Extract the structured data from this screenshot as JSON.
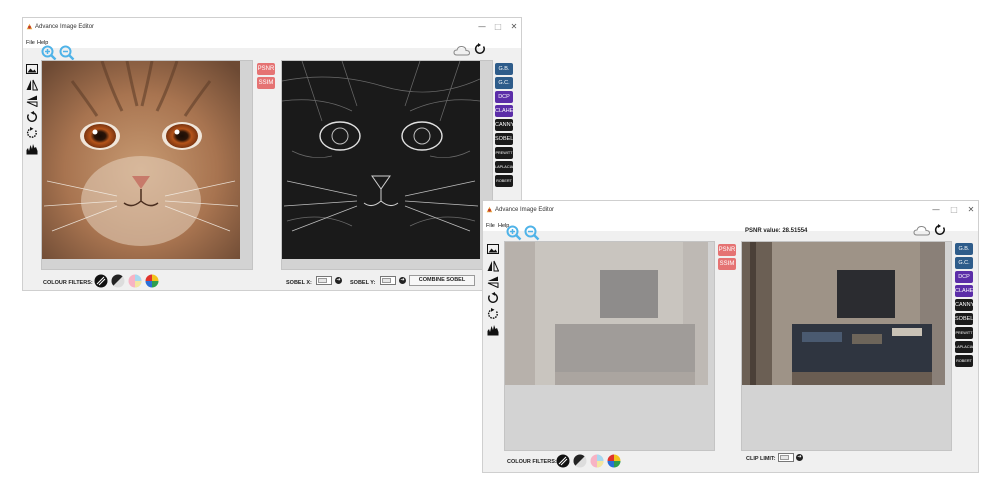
{
  "window_title": "Advance Image Editor",
  "menu": {
    "file": "File",
    "help": "Help"
  },
  "window_buttons": {
    "minimize": "—",
    "maximize": "□",
    "close": "✕"
  },
  "metric_buttons": {
    "psnr": "PSNR",
    "ssim": "SSIM"
  },
  "right_buttons": [
    {
      "label": "G.B.",
      "color": "#2e5c8a"
    },
    {
      "label": "G.C.",
      "color": "#2e5c8a"
    },
    {
      "label": "DCP",
      "color": "#5b2da8"
    },
    {
      "label": "CLAHE",
      "color": "#5b2da8"
    },
    {
      "label": "CANNY",
      "color": "#1a1a1a"
    },
    {
      "label": "SOBEL",
      "color": "#1a1a1a"
    },
    {
      "label": "PREWITT",
      "color": "#1a1a1a"
    },
    {
      "label": "LAPLACIAN",
      "color": "#1a1a1a"
    },
    {
      "label": "ROBERT",
      "color": "#1a1a1a"
    }
  ],
  "left_tools": [
    "image-icon",
    "flip-horizontal-icon",
    "flip-vertical-icon",
    "rotate-left-icon",
    "rotate-right-icon",
    "histogram-icon"
  ],
  "window1": {
    "colour_filters_label": "COLOUR FILTERS:",
    "sobel_x_label": "SOBEL X:",
    "sobel_y_label": "SOBEL Y:",
    "sobel_x_value": "",
    "sobel_y_value": "",
    "combine_sobel_label": "COMBINE SOBEL"
  },
  "window2": {
    "psnr_value_text": "PSNR value: 28.51554",
    "colour_filters_label": "COLOUR FILTERS:",
    "clip_limit_label": "CLIP LIMIT:",
    "clip_limit_value": ""
  },
  "colors": {
    "accent_red": "#e57373",
    "zoom_blue": "#4fb3e8",
    "panel_gray": "#d3d3d3"
  }
}
